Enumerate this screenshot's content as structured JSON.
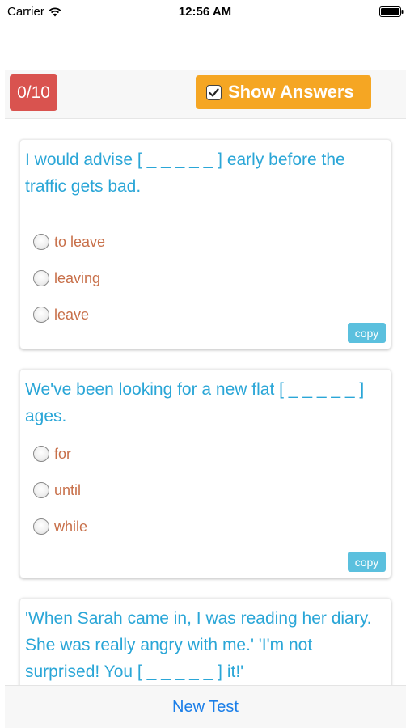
{
  "status_bar": {
    "carrier": "Carrier",
    "time": "12:56 AM"
  },
  "toolbar": {
    "score": "0/10",
    "show_answers_label": "Show Answers",
    "show_answers_checked": true
  },
  "questions": [
    {
      "stem": "I would advise [ _ _ _ _ _ ] early before the traffic gets bad.",
      "options": [
        "to leave",
        "leaving",
        "leave"
      ],
      "copy_label": "copy"
    },
    {
      "stem": "We've been looking for a new flat [ _ _ _ _ _ ] ages.",
      "options": [
        "for",
        "until",
        "while"
      ],
      "copy_label": "copy"
    },
    {
      "stem": "'When Sarah came in, I was reading her diary. She was really angry with me.' 'I'm not surprised! You [ _ _ _ _ _ ] it!'"
    }
  ],
  "bottom_bar": {
    "new_test_label": "New Test"
  },
  "colors": {
    "score_badge": "#d9534f",
    "show_answers": "#f5a623",
    "question_text": "#2aa6d7",
    "option_text": "#c8704a",
    "copy_button": "#5bc0de",
    "link": "#1a7ee8"
  }
}
